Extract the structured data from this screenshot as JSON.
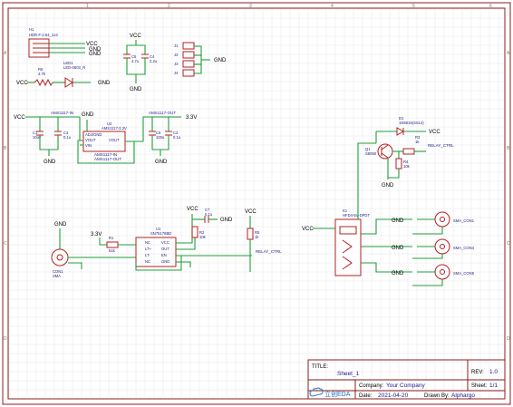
{
  "title_block": {
    "title_label": "TITLE:",
    "title_value": "Sheet_1",
    "rev_label": "REV:",
    "rev_value": "1.0",
    "company_label": "Company:",
    "company_value": "Your Company",
    "sheet_label": "Sheet:",
    "sheet_value": "1/1",
    "date_label": "Date:",
    "date_value": "2021-04-20",
    "drawn_label": "Drawn By:",
    "drawn_value": "Alphargo",
    "logo_text": "立创EDA"
  },
  "ruler": {
    "top": [
      "1",
      "2",
      "3",
      "4",
      "5",
      "6"
    ],
    "side": [
      "A",
      "B",
      "C",
      "D"
    ]
  },
  "power": {
    "vcc": "VCC",
    "gnd": "GND",
    "v33": "3.3V"
  },
  "components": {
    "h1_ref": "H1",
    "h1_val": "HDR-F-2.54_1x3",
    "r6_ref": "R6",
    "r6_val": "4.7k",
    "led1_ref": "LED1",
    "led1_val": "LED-0603_R",
    "c5_ref": "C5",
    "c5_val": "4.7u",
    "c4_ref": "C4",
    "c4_val": "2.2u",
    "j_refs": [
      "J1",
      "J2",
      "J3",
      "J4"
    ],
    "u2_ref": "U2",
    "u2_val": "AMS1117-3.3V",
    "u2_pin1": "ADJ/GND",
    "u2_pin2": "VOUT",
    "u2_pin3": "VIN",
    "u2_pin4": "VOUT",
    "u2_net1": "AMS1117-IN",
    "u2_net2": "AMS1117-OUT",
    "net_in": "AMS1117-IN",
    "net_out": "AMS1117-OUT",
    "c1_ref": "C1",
    "c1_val": "10uF",
    "c3_ref": "C3",
    "c3_val": "0.1u",
    "c6_ref": "C6",
    "c6_val": "100u",
    "c2_ref": "C2",
    "c2_val": "0.1u",
    "d1_ref": "D1",
    "d1_val": "1N5819(SS14)",
    "q1_ref": "Q1",
    "q1_val": "S8050",
    "r3_ref": "R3",
    "r3_val": "1k",
    "r4_ref": "R4",
    "r4_val": "10k",
    "net_relay": "RELAY_CTRL",
    "u1_ref": "U1",
    "u1_val": "SN75176BD",
    "u1_pins_l": [
      "NC",
      "LT+",
      "LT-",
      "NC"
    ],
    "u1_pins_r": [
      "VCC",
      "OUT",
      "EN",
      "GND"
    ],
    "r1_ref": "R1",
    "r1_val": "51k",
    "r2_ref": "R2",
    "r2_val": "10k",
    "c7_ref": "C7",
    "c7_val": "0.1u",
    "r5_ref": "R5",
    "r5_val": "1k",
    "conn_ref": "CON1",
    "conn_val": "SMA",
    "k1_ref": "K1",
    "k1_val": "HFD4-5V-DPDT",
    "sma_labels": [
      "SMA_CON1",
      "SMA_CON4",
      "SMA_CON5"
    ]
  }
}
